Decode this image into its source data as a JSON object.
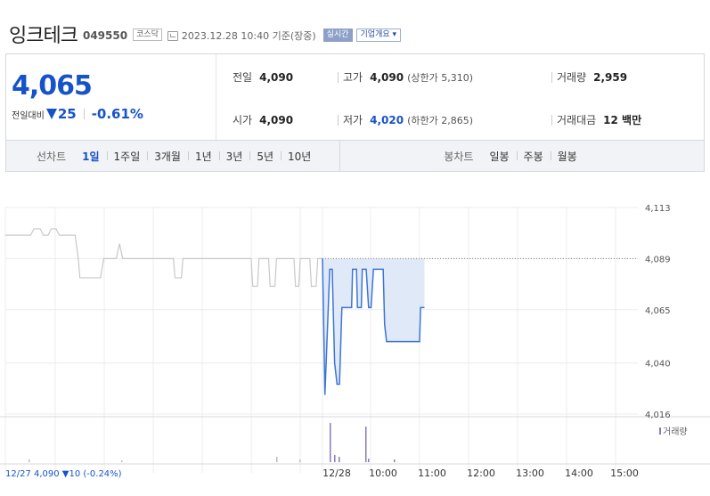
{
  "header": {
    "name": "잉크테크",
    "code": "049550",
    "market": "코스닥",
    "timestamp": "2023.12.28 10:40 기준(장중)",
    "realtime": "실시간",
    "overview": "기업개요 ▾"
  },
  "price": {
    "current": "4,065",
    "change_label": "전일대비",
    "change_amount": "25",
    "change_percent": "-0.61%",
    "direction": "down",
    "color": "#1753c8"
  },
  "stats": {
    "prev_close": {
      "label": "전일",
      "value": "4,090"
    },
    "high": {
      "label": "고가",
      "value": "4,090",
      "sub": "(상한가 5,310)"
    },
    "volume": {
      "label": "거래량",
      "value": "2,959"
    },
    "open": {
      "label": "시가",
      "value": "4,090"
    },
    "low": {
      "label": "저가",
      "value": "4,020",
      "sub": "(하한가 2,865)"
    },
    "amount": {
      "label": "거래대금",
      "value": "12 백만"
    }
  },
  "tabs": {
    "line_label": "선차트",
    "line": [
      "1일",
      "1주일",
      "3개월",
      "1년",
      "3년",
      "5년",
      "10년"
    ],
    "line_active": 0,
    "candle_label": "봉차트",
    "candle": [
      "일봉",
      "주봉",
      "월봉"
    ]
  },
  "chart_data": {
    "type": "line",
    "y_ticks": [
      "4,113",
      "4,089",
      "4,065",
      "4,040",
      "4,016"
    ],
    "y_tick_values": [
      4113,
      4089,
      4065,
      4040,
      4016
    ],
    "ylim": [
      4016,
      4113
    ],
    "x_ticks": [
      "12/28",
      "10:00",
      "11:00",
      "12:00",
      "13:00",
      "14:00",
      "15:00"
    ],
    "volume_label": "거래량",
    "prev_day_summary": "12/27 4,090 ▼10 (-0.24%)",
    "prev_day_series": {
      "points": [
        [
          0,
          4100
        ],
        [
          0.8,
          4100
        ],
        [
          0.9,
          4103
        ],
        [
          1.1,
          4103
        ],
        [
          1.2,
          4100
        ],
        [
          1.35,
          4100
        ],
        [
          1.45,
          4103
        ],
        [
          1.6,
          4103
        ],
        [
          1.7,
          4100
        ],
        [
          2.2,
          4100
        ],
        [
          2.3,
          4089
        ],
        [
          2.35,
          4080
        ],
        [
          3.0,
          4080
        ],
        [
          3.1,
          4089
        ],
        [
          3.15,
          4089
        ],
        [
          3.5,
          4089
        ],
        [
          3.6,
          4096
        ],
        [
          3.7,
          4089
        ],
        [
          5.3,
          4089
        ],
        [
          5.35,
          4080
        ],
        [
          5.55,
          4080
        ],
        [
          5.6,
          4089
        ],
        [
          7.75,
          4089
        ],
        [
          7.8,
          4076
        ],
        [
          7.95,
          4076
        ],
        [
          8.0,
          4089
        ],
        [
          8.3,
          4089
        ],
        [
          8.35,
          4076
        ],
        [
          8.5,
          4076
        ],
        [
          8.55,
          4089
        ],
        [
          9.1,
          4089
        ],
        [
          9.15,
          4076
        ],
        [
          9.25,
          4076
        ],
        [
          9.3,
          4089
        ],
        [
          9.6,
          4089
        ],
        [
          9.65,
          4076
        ],
        [
          9.8,
          4076
        ],
        [
          9.85,
          4089
        ],
        [
          10.0,
          4089
        ]
      ]
    },
    "today_series": {
      "points": [
        [
          0,
          4089
        ],
        [
          0.05,
          4025
        ],
        [
          0.15,
          4084
        ],
        [
          0.2,
          4084
        ],
        [
          0.25,
          4040
        ],
        [
          0.3,
          4030
        ],
        [
          0.35,
          4030
        ],
        [
          0.4,
          4066
        ],
        [
          0.5,
          4066
        ],
        [
          0.6,
          4066
        ],
        [
          0.62,
          4084
        ],
        [
          0.7,
          4084
        ],
        [
          0.72,
          4066
        ],
        [
          0.8,
          4066
        ],
        [
          0.82,
          4084
        ],
        [
          0.9,
          4084
        ],
        [
          0.95,
          4066
        ],
        [
          1.0,
          4066
        ],
        [
          1.05,
          4084
        ],
        [
          1.12,
          4084
        ],
        [
          1.2,
          4084
        ],
        [
          1.25,
          4084
        ],
        [
          1.28,
          4058
        ],
        [
          1.32,
          4050
        ],
        [
          1.4,
          4050
        ],
        [
          2.0,
          4050
        ],
        [
          2.02,
          4066
        ],
        [
          2.1,
          4066
        ]
      ]
    },
    "prev_close_line": 4089
  }
}
